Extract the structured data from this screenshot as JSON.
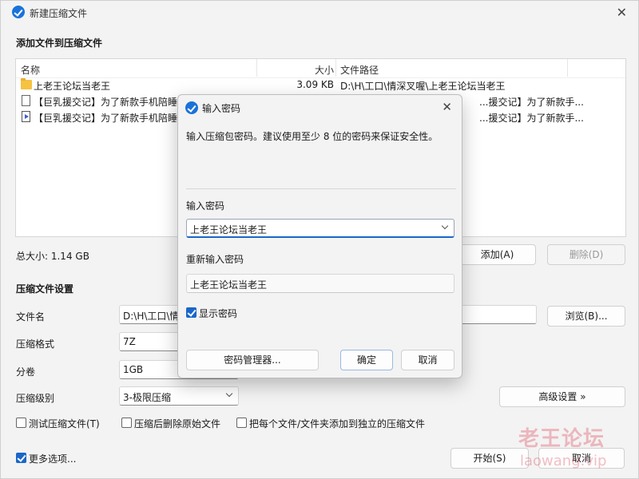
{
  "window": {
    "title": "新建压缩文件",
    "close_glyph": "✕"
  },
  "file_section": {
    "title": "添加文件到压缩文件"
  },
  "file_list": {
    "columns": [
      "名称",
      "大小",
      "文件路径"
    ],
    "rows": [
      {
        "icon": "folder-icon",
        "name": "上老王论坛当老王",
        "size": "3.09 KB",
        "path": "D:\\H\\工口\\情深叉喔\\上老王论坛当老王"
      },
      {
        "icon": "document-icon",
        "name": "【巨乳援交记】为了新款手机陪睡",
        "size": "",
        "path": "...援交记】为了新款手..."
      },
      {
        "icon": "video-icon",
        "name": "【巨乳援交记】为了新款手机陪睡",
        "size": "",
        "path": "...援交记】为了新款手..."
      }
    ]
  },
  "summary": {
    "total_size": "总大小: 1.14 GB",
    "add_label": "添加(A)",
    "delete_label": "删除(D)"
  },
  "settings": {
    "title": "压缩文件设置",
    "filename_label": "文件名",
    "filename_value": "D:\\H\\工口\\情",
    "browse_label": "浏览(B)...",
    "format_label": "压缩格式",
    "format_value": "7Z",
    "split_label": "分卷",
    "split_value": "1GB",
    "level_label": "压缩级别",
    "level_value": "3-极限压缩",
    "advanced_label": "高级设置 »",
    "test_label": "测试压缩文件(T)",
    "delete_after_label": "压缩后删除原始文件",
    "separate_label": "把每个文件/文件夹添加到独立的压缩文件",
    "more_options_label": "更多选项...",
    "start_label": "开始(S)",
    "cancel_label": "取消"
  },
  "dialog": {
    "title": "输入密码",
    "close_glyph": "✕",
    "description": "输入压缩包密码。建议使用至少 8 位的密码来保证安全性。",
    "password_label": "输入密码",
    "password_value": "上老王论坛当老王",
    "reenter_label": "重新输入密码",
    "reenter_value": "上老王论坛当老王",
    "show_password_label": "显示密码",
    "manager_label": "密码管理器...",
    "ok_label": "确定",
    "cancel_label": "取消"
  },
  "watermark": {
    "line1": "老王论坛",
    "line2": "laowang.vip"
  },
  "colors": {
    "accent": "#1a66c9",
    "background": "#f3f3f3",
    "watermark": "#dc465a"
  }
}
